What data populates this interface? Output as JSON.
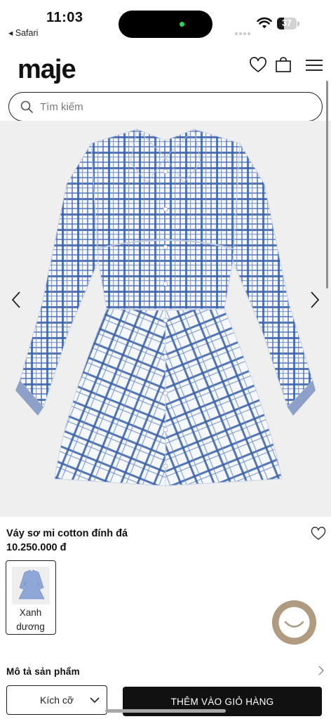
{
  "status_bar": {
    "time": "11:03",
    "back_app": "◂ Safari",
    "battery_level": "37",
    "battery_fraction": 0.37,
    "icons": [
      "signal-dots-icon",
      "wifi-icon",
      "battery-icon"
    ]
  },
  "header": {
    "logo": "maje",
    "icons": [
      "heart-icon",
      "shopping-bag-icon",
      "hamburger-menu-icon"
    ]
  },
  "search": {
    "placeholder": "Tìm kiếm",
    "icon": "search-icon"
  },
  "gallery": {
    "image_description": "blue and white checked long-sleeve shirt dress",
    "prev_icon": "chevron-left-icon",
    "next_icon": "chevron-right-icon"
  },
  "product": {
    "name": "Váy sơ mi cotton đính đá",
    "price": "10.250.000 đ",
    "wishlist_icon": "heart-outline-icon"
  },
  "color_swatch": {
    "label_line1": "Xanh",
    "label_line2": "dương"
  },
  "description": {
    "title": "Mô tả sản phẩm",
    "icon": "chevron-right-icon"
  },
  "actions": {
    "size_label": "Kích cỡ",
    "add_to_cart": "THÊM VÀO GIỎ HÀNG"
  },
  "colors": {
    "accent": "#111111",
    "chat_bubble": "#b09b80",
    "check_blue": "#3a5fa8",
    "gallery_bg": "#efefef"
  }
}
